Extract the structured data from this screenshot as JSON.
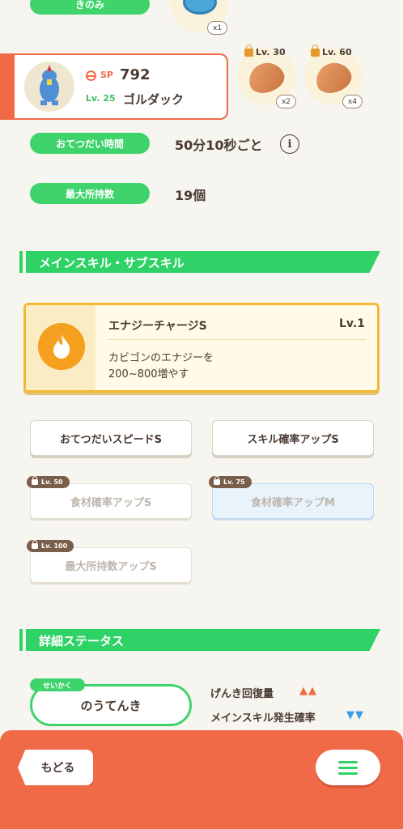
{
  "top": {
    "ingredient_label": "きのみ",
    "berry_count": "x1"
  },
  "pokemon": {
    "sp_label": "SP",
    "sp_value": "792",
    "level": "Lv. 25",
    "name": "ゴルダック"
  },
  "ingredients": [
    {
      "level": "Lv. 30",
      "count": "x2"
    },
    {
      "level": "Lv. 60",
      "count": "x4"
    }
  ],
  "stats": {
    "help_time_label": "おてつだい時間",
    "help_time_value": "50分10秒ごと",
    "info_icon": "i",
    "carry_label": "最大所持数",
    "carry_value": "19個"
  },
  "skills_section": {
    "title": "メインスキル・サブスキル",
    "main_skill": {
      "name": "エナジーチャージS",
      "level": "Lv.1",
      "description_line1": "カビゴンのエナジーを",
      "description_line2": "200~800増やす",
      "icon": "fire-icon"
    },
    "sub_skills": [
      {
        "label": "おてつだいスピードS"
      },
      {
        "label": "スキル確率アップS"
      },
      {
        "label": "食材確率アップS",
        "unlock": "Lv. 50"
      },
      {
        "label": "食材確率アップM",
        "unlock": "Lv. 75"
      },
      {
        "label": "最大所持数アップS",
        "unlock": "Lv. 100"
      }
    ]
  },
  "detail_section": {
    "title": "詳細ステータス",
    "nature_tag": "せいかく",
    "nature_value": "のうてんき",
    "effects": [
      {
        "label": "げんき回復量",
        "marks": "▲▲",
        "color": "#ee6a45"
      },
      {
        "label": "メインスキル発生確率",
        "marks": "▼▼",
        "color": "#3c9ce8"
      }
    ]
  },
  "footer": {
    "back_label": "もどる",
    "menu_icon": "menu-icon"
  },
  "colors": {
    "accent_green": "#2fd266",
    "footer_orange": "#f06a48"
  }
}
